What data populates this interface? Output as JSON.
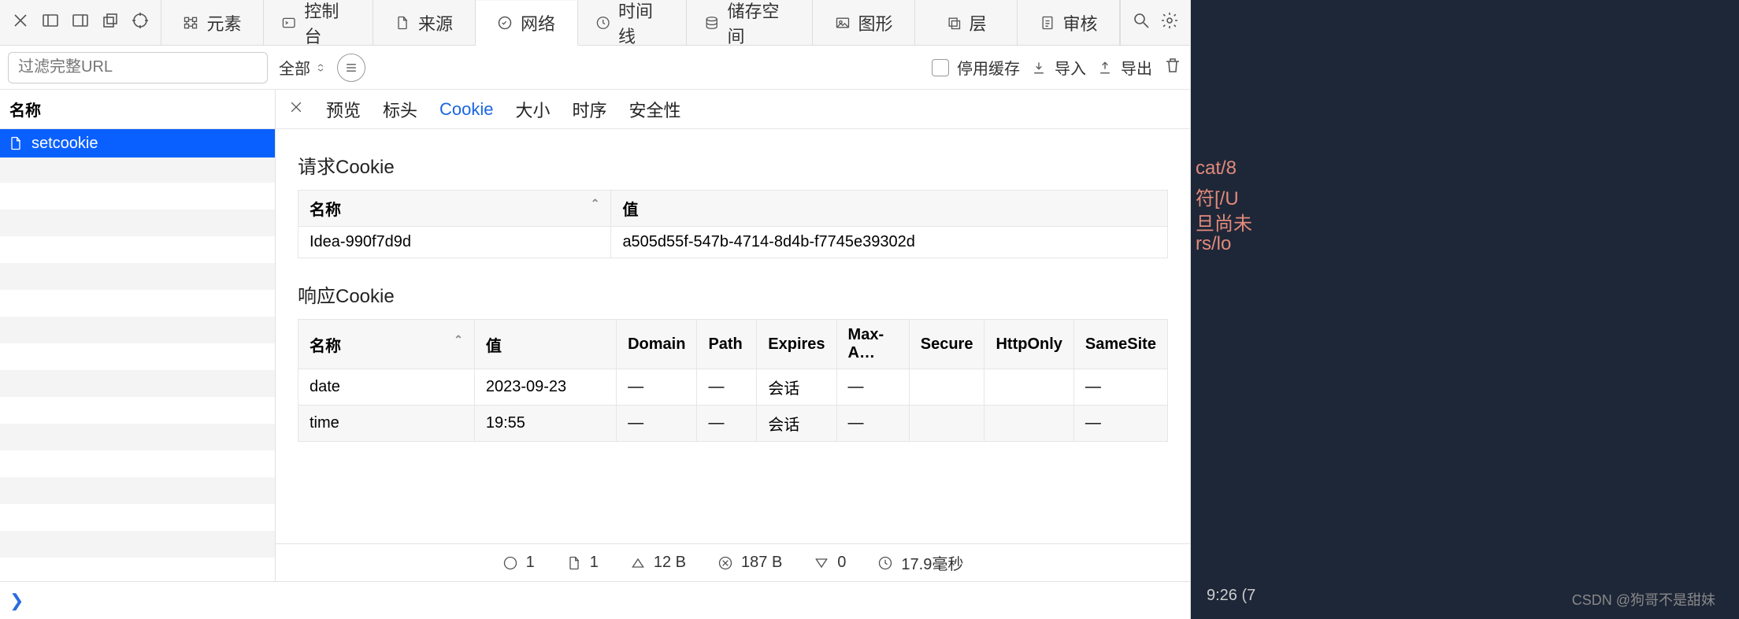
{
  "toolbar": {
    "tabs": [
      {
        "label": "元素"
      },
      {
        "label": "控制台"
      },
      {
        "label": "来源"
      },
      {
        "label": "网络"
      },
      {
        "label": "时间线"
      },
      {
        "label": "储存空间"
      },
      {
        "label": "图形"
      },
      {
        "label": "层"
      },
      {
        "label": "审核"
      }
    ],
    "active_tab_index": 3
  },
  "filterbar": {
    "url_placeholder": "过滤完整URL",
    "all_label": "全部",
    "disable_cache_label": "停用缓存",
    "import_label": "导入",
    "export_label": "导出"
  },
  "sidebar": {
    "header": "名称",
    "items": [
      {
        "label": "setcookie"
      }
    ]
  },
  "detail_tabs": {
    "items": [
      "预览",
      "标头",
      "Cookie",
      "大小",
      "时序",
      "安全性"
    ],
    "active_index": 2
  },
  "request_cookies": {
    "title": "请求Cookie",
    "columns": [
      "名称",
      "值"
    ],
    "rows": [
      {
        "name": "Idea-990f7d9d",
        "value": "a505d55f-547b-4714-8d4b-f7745e39302d"
      }
    ]
  },
  "response_cookies": {
    "title": "响应Cookie",
    "columns": [
      "名称",
      "值",
      "Domain",
      "Path",
      "Expires",
      "Max-A…",
      "Secure",
      "HttpOnly",
      "SameSite"
    ],
    "rows": [
      {
        "name": "date",
        "value": "2023-09-23",
        "domain": "—",
        "path": "—",
        "expires": "会话",
        "maxage": "—",
        "secure": "",
        "httponly": "",
        "samesite": "—"
      },
      {
        "name": "time",
        "value": "19:55",
        "domain": "—",
        "path": "—",
        "expires": "会话",
        "maxage": "—",
        "secure": "",
        "httponly": "",
        "samesite": "—"
      }
    ]
  },
  "statusbar": {
    "requests": "1",
    "documents": "1",
    "transfer": "12 B",
    "resources": "187 B",
    "errors": "0",
    "time": "17.9毫秒"
  },
  "side_panel": {
    "lines": [
      "cat/8",
      "符[/U",
      "旦尚未",
      "rs/lo"
    ],
    "clock": "9:26 (7",
    "watermark": "CSDN @狗哥不是甜妹"
  }
}
